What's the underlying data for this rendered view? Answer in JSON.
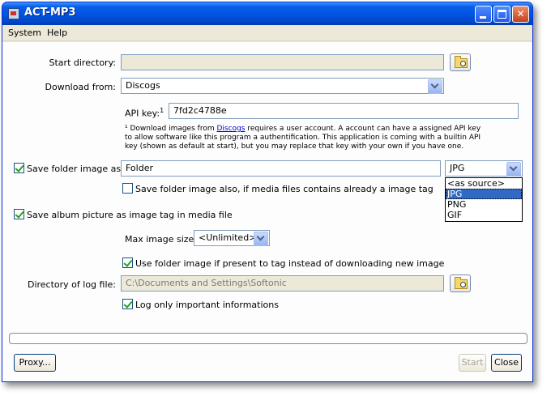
{
  "window": {
    "title": "ACT-MP3"
  },
  "menu": {
    "items": [
      "System",
      "Help"
    ]
  },
  "form": {
    "start_directory": {
      "label": "Start directory:",
      "value": ""
    },
    "download_from": {
      "label": "Download from:",
      "value": "Discogs"
    },
    "api_key": {
      "label": "API key:",
      "footnote_mark": "1",
      "value": "7fd2c4788e"
    },
    "note": {
      "prefix": "¹ Download images from ",
      "link": "Discogs",
      "suffix": " requires a user account. A account can have a assigned API key to allow software like this program a authentification. This application is coming with a builtin API key (shown as default at start), but you may replace that key with your own if you have one."
    },
    "save_folder_image": {
      "label": "Save folder image as:",
      "checked": true,
      "value": "Folder",
      "format": "JPG",
      "format_options": [
        "<as source>",
        "JPG",
        "PNG",
        "GIF"
      ]
    },
    "save_folder_also": {
      "label": "Save folder image also, if media files contains already a image tag",
      "checked": false
    },
    "save_album_picture": {
      "label": "Save album picture as image tag in media file",
      "checked": true
    },
    "max_image_size": {
      "label": "Max image size:",
      "value": "<Unlimited>"
    },
    "use_folder_image": {
      "label": "Use folder image if present to tag instead of downloading new image",
      "checked": true
    },
    "log_directory": {
      "label": "Directory of log file:",
      "value": "C:\\Documents and Settings\\Softonic"
    },
    "log_important": {
      "label": "Log only important informations",
      "checked": true
    }
  },
  "progress": 0,
  "buttons": {
    "proxy": "Proxy...",
    "start": "Start",
    "close": "Close"
  }
}
